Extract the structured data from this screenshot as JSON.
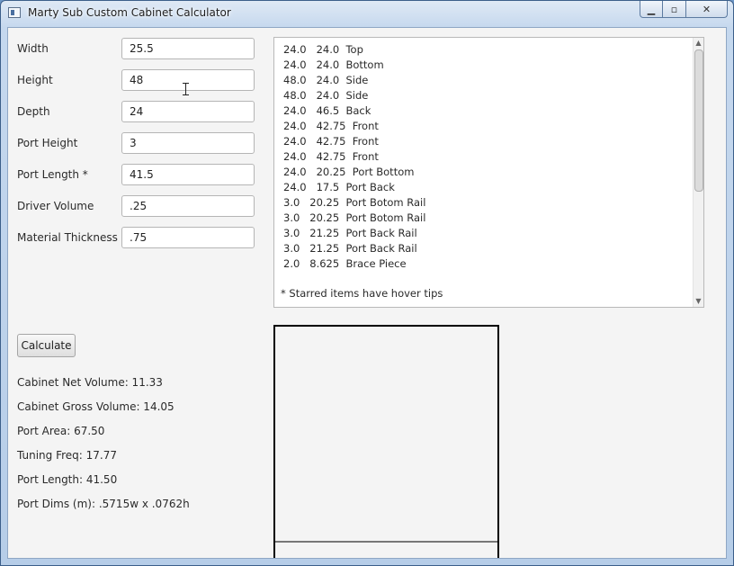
{
  "window": {
    "title": "Marty Sub Custom Cabinet Calculator",
    "controls": {
      "minimize": "▁",
      "maximize": "▫",
      "close": "✕"
    }
  },
  "form": {
    "fields": [
      {
        "label": "Width",
        "value": "25.5"
      },
      {
        "label": "Height",
        "value": "48"
      },
      {
        "label": "Depth",
        "value": "24"
      },
      {
        "label": "Port Height",
        "value": "3"
      },
      {
        "label": "Port Length *",
        "value": "41.5"
      },
      {
        "label": "Driver Volume",
        "value": ".25"
      },
      {
        "label": "Material Thickness *",
        "value": ".75"
      }
    ],
    "calculate_label": "Calculate"
  },
  "cut_list": {
    "items": [
      "24.0   24.0  Top",
      "24.0   24.0  Bottom",
      "48.0   24.0  Side",
      "48.0   24.0  Side",
      "24.0   46.5  Back",
      "24.0   42.75  Front",
      "24.0   42.75  Front",
      "24.0   42.75  Front",
      "24.0   20.25  Port Bottom",
      "24.0   17.5  Port Back",
      "3.0   20.25  Port Botom Rail",
      "3.0   20.25  Port Botom Rail",
      "3.0   21.25  Port Back Rail",
      "3.0   21.25  Port Back Rail",
      "2.0   8.625  Brace Piece"
    ],
    "note": "* Starred items have hover tips"
  },
  "results": [
    "Cabinet Net Volume: 11.33",
    "Cabinet Gross Volume: 14.05",
    "Port Area: 67.50",
    "Tuning Freq: 17.77",
    "Port Length: 41.50",
    "Port Dims (m): .5715w x .0762h"
  ]
}
